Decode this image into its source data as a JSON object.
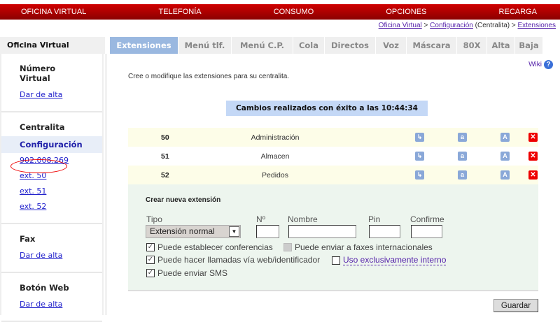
{
  "topnav": [
    "OFICINA VIRTUAL",
    "TELEFONÍA",
    "CONSUMO",
    "OPCIONES",
    "RECARGA"
  ],
  "breadcrumb": {
    "a": "Oficina Virtual",
    "sep1": " > ",
    "b": "Configuración",
    "mid": " (Centralita) > ",
    "c": "Extensiones"
  },
  "sidebar": {
    "title": "Oficina Virtual",
    "numero": {
      "title": "Número Virtual",
      "link": "Dar de alta"
    },
    "centralita": {
      "title": "Centralita",
      "active": "Configuración",
      "links": [
        "902.008.269",
        "ext. 50",
        "ext. 51",
        "ext. 52"
      ]
    },
    "fax": {
      "title": "Fax",
      "link": "Dar de alta"
    },
    "boton": {
      "title": "Botón Web",
      "link": "Dar de alta"
    }
  },
  "tabs": [
    "Extensiones",
    "Menú tlf.",
    "Menú C.P.",
    "Cola",
    "Directos",
    "Voz",
    "Máscara",
    "80X",
    "Alta",
    "Baja"
  ],
  "intro": "Cree o modifique las extensiones para su centralita.",
  "wiki": "Wiki",
  "message": "Cambios realizados con éxito a las 10:44:34",
  "extensions": [
    {
      "num": "50",
      "name": "Administración"
    },
    {
      "num": "51",
      "name": "Almacen"
    },
    {
      "num": "52",
      "name": "Pedidos"
    }
  ],
  "form": {
    "title": "Crear nueva extensión",
    "tipo": "Tipo",
    "num": "Nº",
    "nombre": "Nombre",
    "pin": "Pin",
    "confirme": "Confirme",
    "tipo_value": "Extensión normal",
    "chk1": "Puede establecer conferencias",
    "chk2": "Puede enviar a faxes internacionales",
    "chk3": "Puede hacer llamadas vía web/identificador",
    "chk4": "Uso exclusivamente interno",
    "chk5": "Puede enviar SMS"
  },
  "save": "Guardar"
}
